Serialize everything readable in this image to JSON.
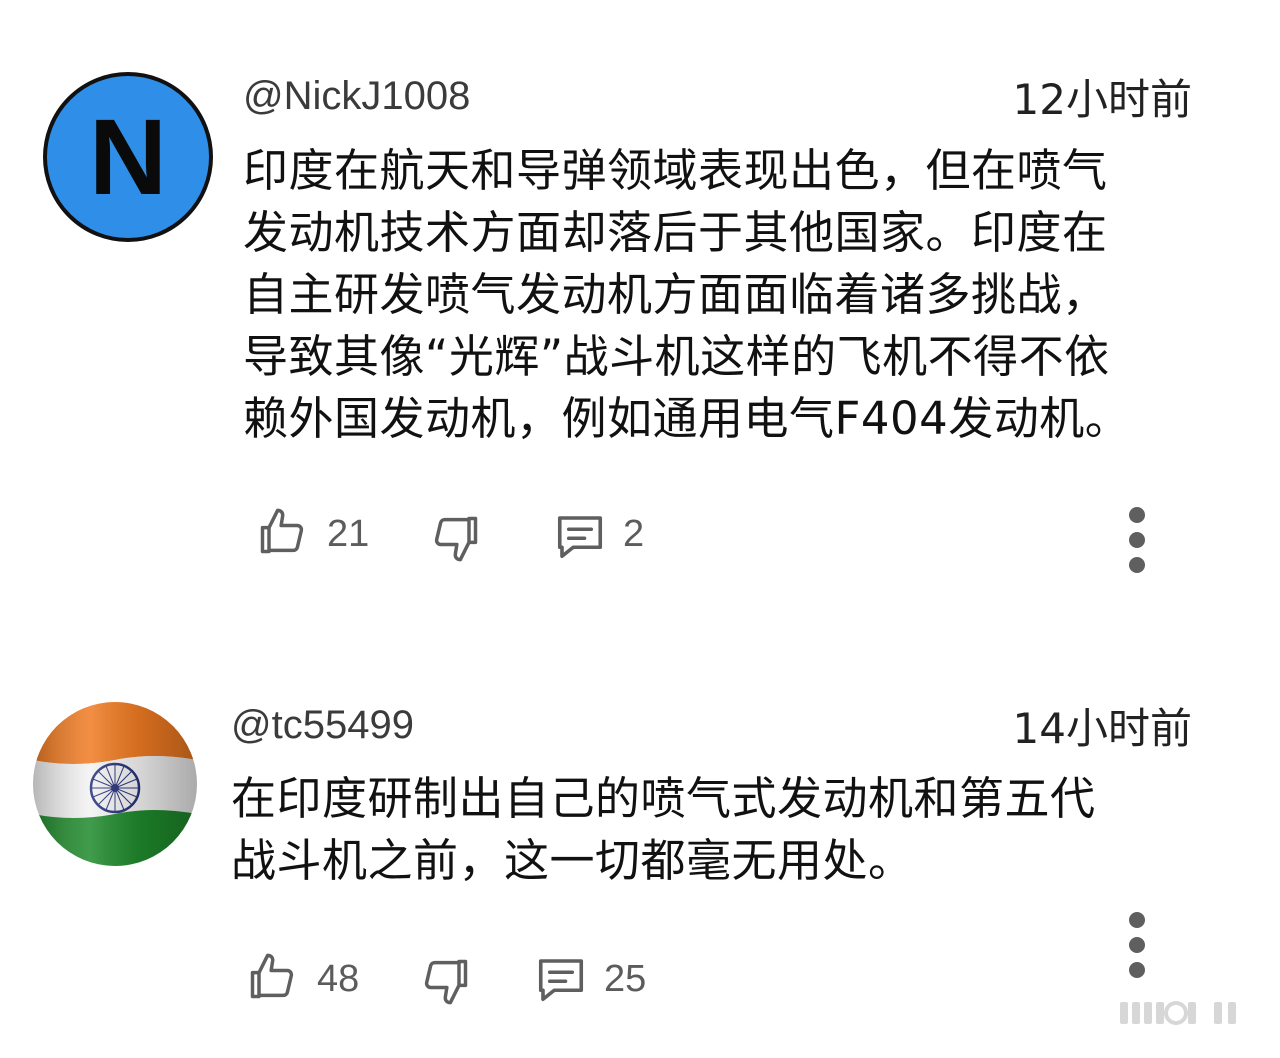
{
  "comments": [
    {
      "handle": "@NickJ1008",
      "time": "12小时前",
      "avatar_letter": "N",
      "lines": [
        "印度在航天和导弹领域表现出色，但在喷气",
        "发动机技术方面却落后于其他国家。印度在",
        "自主研发喷气发动机方面面临着诸多挑战，",
        "导致其像“光辉”战斗机这样的飞机不得不依",
        "赖外国发动机，例如通用电气F404发动机。"
      ],
      "likes": "21",
      "replies": "2"
    },
    {
      "handle": "@tc55499",
      "time": "14小时前",
      "lines": [
        "在印度研制出自己的喷气式发动机和第五代",
        "战斗机之前，这一切都毫无用处。"
      ],
      "likes": "48",
      "replies": "25"
    }
  ],
  "colors": {
    "avatar_blue": "#2f8ee8",
    "icon_gray": "#5f5f5f"
  },
  "icons": [
    "like-icon",
    "dislike-icon",
    "reply-icon",
    "more-icon"
  ]
}
